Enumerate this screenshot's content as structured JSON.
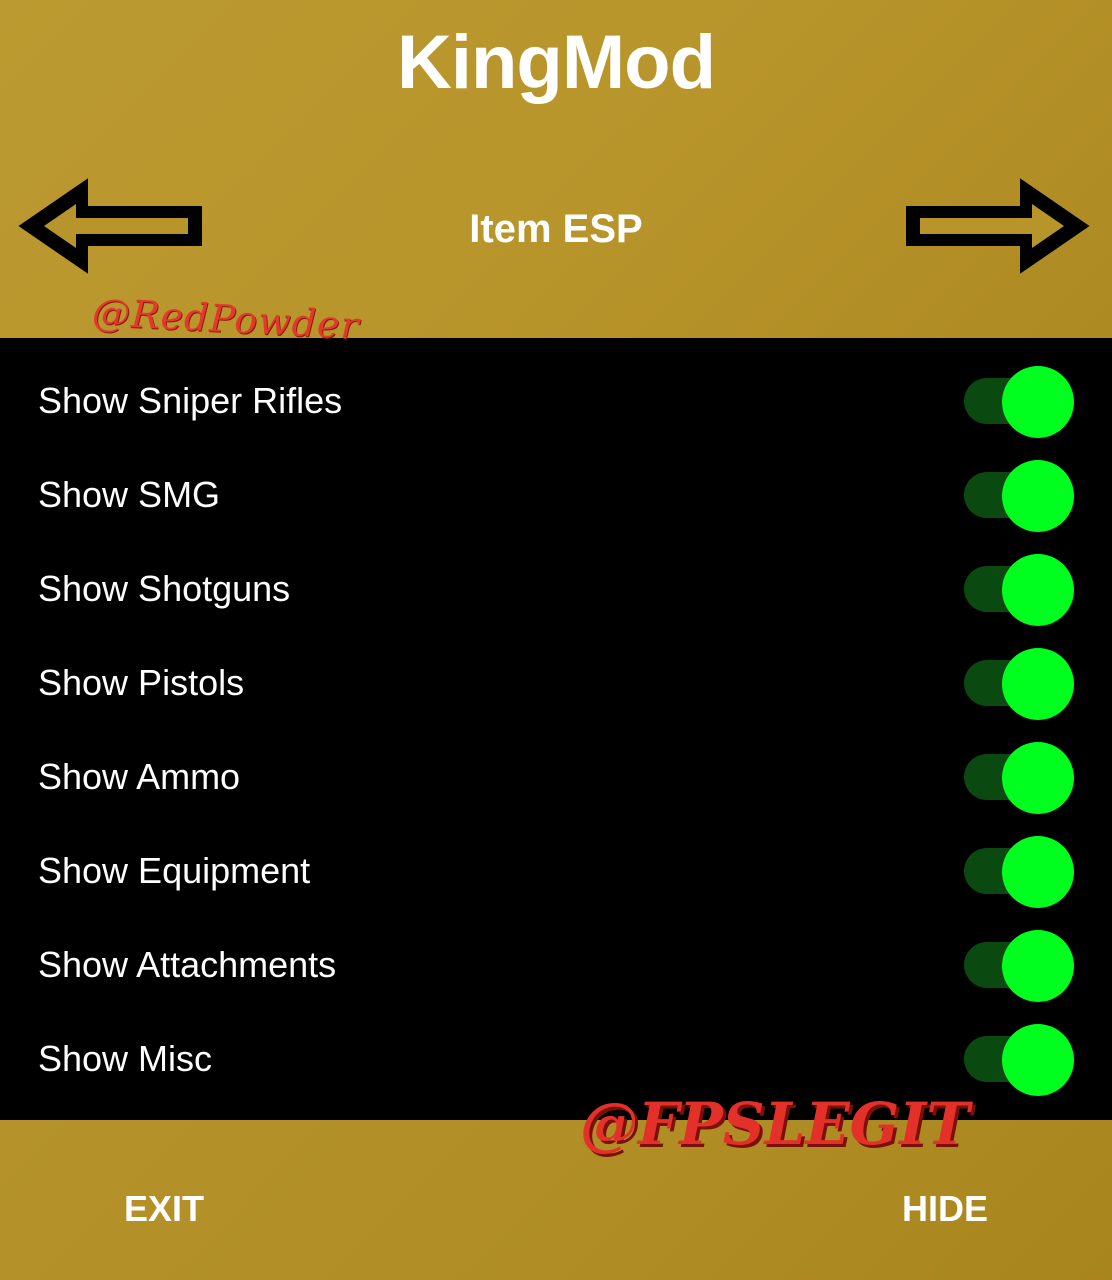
{
  "header": {
    "app_title": "KingMod",
    "page_title": "Item ESP",
    "prev_icon": "arrow-left-icon",
    "next_icon": "arrow-right-icon"
  },
  "watermarks": {
    "top": "@RedPowder",
    "bottom": "@FPSLEGIT"
  },
  "items": [
    {
      "label": "Show Sniper Rifles",
      "enabled": true
    },
    {
      "label": "Show SMG",
      "enabled": true
    },
    {
      "label": "Show Shotguns",
      "enabled": true
    },
    {
      "label": "Show Pistols",
      "enabled": true
    },
    {
      "label": "Show Ammo",
      "enabled": true
    },
    {
      "label": "Show Equipment",
      "enabled": true
    },
    {
      "label": "Show Attachments",
      "enabled": true
    },
    {
      "label": "Show Misc",
      "enabled": true
    }
  ],
  "footer": {
    "exit_label": "EXIT",
    "hide_label": "HIDE"
  },
  "colors": {
    "header_bg": "#b8952b",
    "list_bg": "#000000",
    "toggle_on_knob": "#00ff1e",
    "toggle_on_track": "#0a4a10",
    "watermark": "#e3312a"
  }
}
